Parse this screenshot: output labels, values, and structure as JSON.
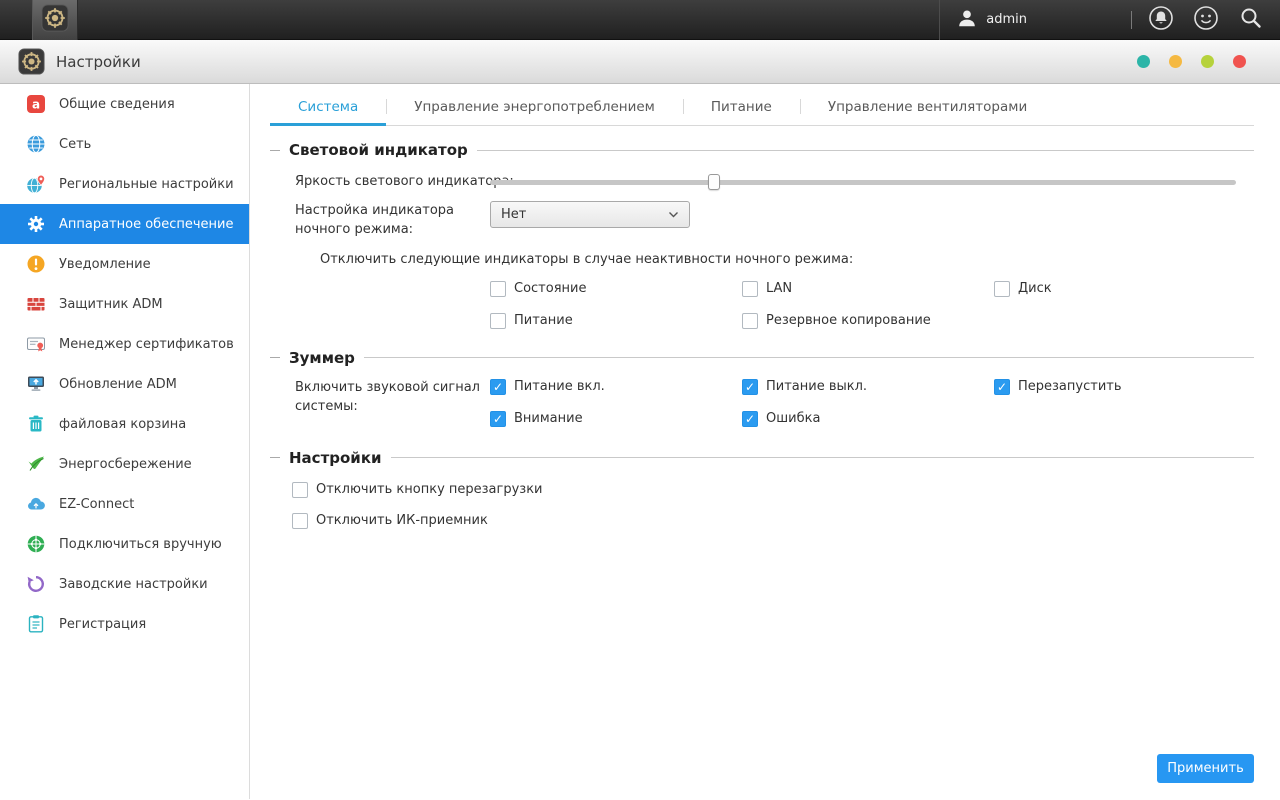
{
  "topbar": {
    "username": "admin"
  },
  "window": {
    "title": "Настройки",
    "dot_colors": [
      "#2cb5a8",
      "#f5b942",
      "#b6d23c",
      "#f0534f"
    ]
  },
  "sidebar": {
    "items": [
      {
        "label": "Общие сведения"
      },
      {
        "label": "Сеть"
      },
      {
        "label": "Региональные настройки"
      },
      {
        "label": "Аппаратное обеспечение",
        "active": true
      },
      {
        "label": "Уведомление"
      },
      {
        "label": "Защитник ADM"
      },
      {
        "label": "Менеджер сертификатов"
      },
      {
        "label": "Обновление ADM"
      },
      {
        "label": "файловая корзина"
      },
      {
        "label": "Энергосбережение"
      },
      {
        "label": "EZ-Connect"
      },
      {
        "label": "Подключиться вручную"
      },
      {
        "label": "Заводские настройки"
      },
      {
        "label": "Регистрация"
      }
    ]
  },
  "tabs": [
    {
      "label": "Система",
      "active": true
    },
    {
      "label": "Управление энергопотреблением",
      "active": false
    },
    {
      "label": "Питание",
      "active": false
    },
    {
      "label": "Управление вентиляторами",
      "active": false
    }
  ],
  "led_section": {
    "title": "Световой индикатор",
    "brightness_label": "Яркость светового индикатора:",
    "brightness_percent": 30,
    "night_mode_label": "Настройка индикатора ночного режима:",
    "night_mode_value": "Нет",
    "disable_note": "Отключить следующие индикаторы в случае неактивности ночного режима:",
    "checkboxes": [
      {
        "label": "Состояние",
        "checked": false
      },
      {
        "label": "LAN",
        "checked": false
      },
      {
        "label": "Диск",
        "checked": false
      },
      {
        "label": "Питание",
        "checked": false
      },
      {
        "label": "Резервное копирование",
        "checked": false
      }
    ]
  },
  "buzzer_section": {
    "title": "Зуммер",
    "enable_label": "Включить звуковой сигнал системы:",
    "checkboxes": [
      {
        "label": "Питание вкл.",
        "checked": true
      },
      {
        "label": "Питание выкл.",
        "checked": true
      },
      {
        "label": "Перезапустить",
        "checked": true
      },
      {
        "label": "Внимание",
        "checked": true
      },
      {
        "label": "Ошибка",
        "checked": true
      }
    ]
  },
  "settings_section": {
    "title": "Настройки",
    "checkboxes": [
      {
        "label": "Отключить кнопку перезагрузки",
        "checked": false
      },
      {
        "label": "Отключить ИК-приемник",
        "checked": false
      }
    ]
  },
  "apply_button_label": "Применить",
  "colors": {
    "sidebar_active_bg": "#1e87e5",
    "tab_active": "#2aa0d8",
    "checkbox_checked": "#2b9bf0",
    "apply_button_bg": "#2797f2"
  }
}
